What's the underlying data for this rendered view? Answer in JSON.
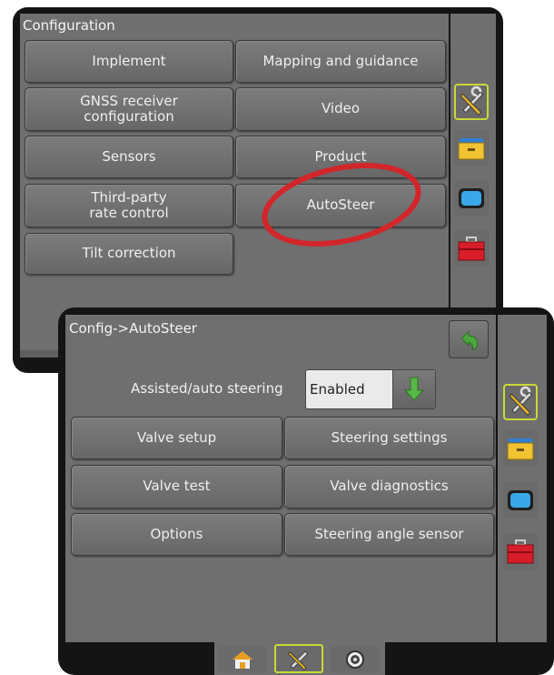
{
  "config_screen": {
    "title": "Configuration",
    "buttons": [
      {
        "label": "Implement"
      },
      {
        "label": "Mapping and guidance"
      },
      {
        "label": "GNSS receiver\nconfiguration"
      },
      {
        "label": "Video"
      },
      {
        "label": "Sensors"
      },
      {
        "label": "Product"
      },
      {
        "label": "Third-party\nrate control"
      },
      {
        "label": "AutoSteer"
      },
      {
        "label": "Tilt correction"
      }
    ],
    "side_tabs": [
      "tools-icon",
      "folder-icon",
      "screen-icon",
      "toolbox-icon"
    ]
  },
  "autosteer_screen": {
    "title": "Config->AutoSteer",
    "assisted_label": "Assisted/auto steering",
    "assisted_value": "Enabled",
    "buttons": [
      {
        "label": "Valve setup"
      },
      {
        "label": "Steering settings"
      },
      {
        "label": "Valve test"
      },
      {
        "label": "Valve diagnostics"
      },
      {
        "label": "Options"
      },
      {
        "label": "Steering angle sensor"
      }
    ],
    "side_tabs": [
      "tools-icon",
      "folder-icon",
      "screen-icon",
      "toolbox-icon"
    ],
    "bottom_tabs": [
      "home-icon",
      "tools-icon",
      "gauge-icon"
    ]
  },
  "colors": {
    "active_tab_border": "#c9d937",
    "highlight_circle": "#d2262b",
    "back_arrow": "#4aa83a"
  }
}
